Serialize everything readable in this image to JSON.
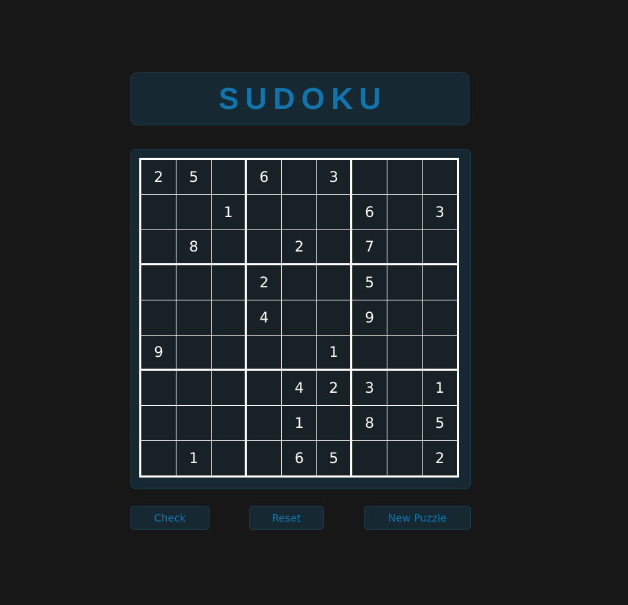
{
  "title": "SUDOKU",
  "colors": {
    "accent": "#1274ad",
    "background": "#171717",
    "panel": "#162932",
    "cell": "#172126",
    "grid_lines": "#ffffff"
  },
  "board": [
    [
      "2",
      "5",
      "",
      "6",
      "",
      "3",
      "",
      "",
      ""
    ],
    [
      "",
      "",
      "1",
      "",
      "",
      "",
      "6",
      "",
      "3"
    ],
    [
      "",
      "8",
      "",
      "",
      "2",
      "",
      "7",
      "",
      ""
    ],
    [
      "",
      "",
      "",
      "2",
      "",
      "",
      "5",
      "",
      ""
    ],
    [
      "",
      "",
      "",
      "4",
      "",
      "",
      "9",
      "",
      ""
    ],
    [
      "9",
      "",
      "",
      "",
      "",
      "1",
      "",
      "",
      ""
    ],
    [
      "",
      "",
      "",
      "",
      "4",
      "2",
      "3",
      "",
      "1"
    ],
    [
      "",
      "",
      "",
      "",
      "1",
      "",
      "8",
      "",
      "5"
    ],
    [
      "",
      "1",
      "",
      "",
      "6",
      "5",
      "",
      "",
      "2"
    ]
  ],
  "buttons": {
    "check": "Check",
    "reset": "Reset",
    "new_puzzle": "New Puzzle"
  }
}
